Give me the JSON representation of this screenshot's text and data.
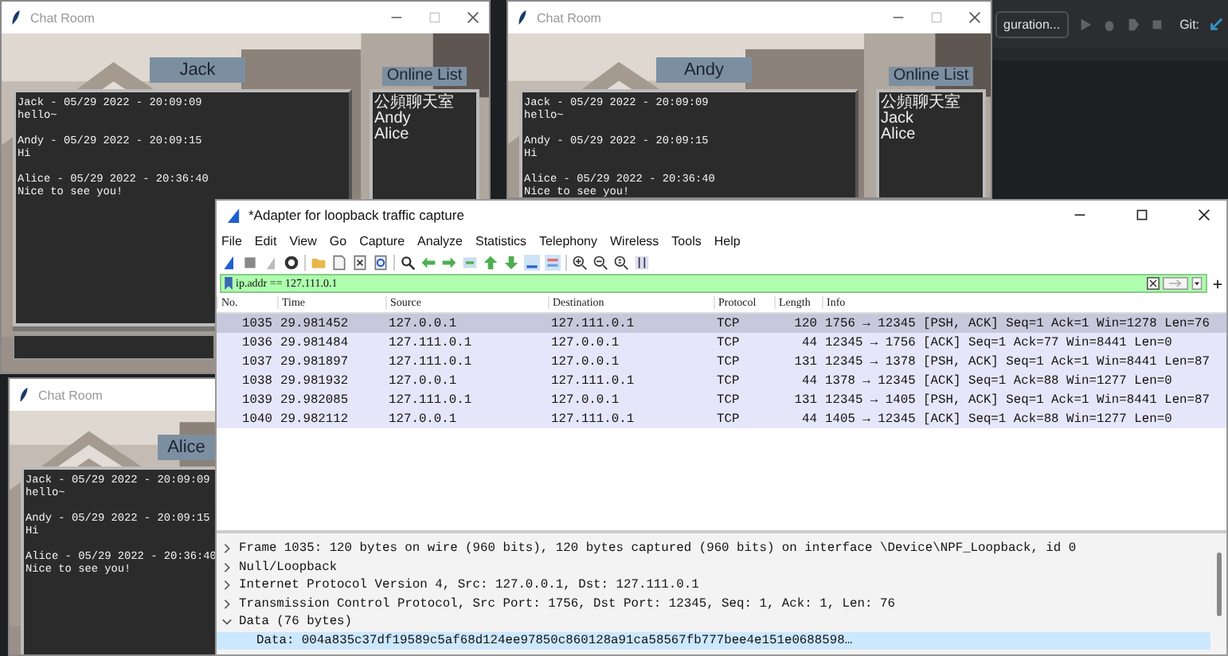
{
  "ide": {
    "run_config": "guration...",
    "vcs_label": "Git:"
  },
  "chat_windows": [
    {
      "title": "Chat Room",
      "title_buttons": true,
      "user": "Jack",
      "show_entry": true,
      "messages": [
        {
          "header": "Jack - 05/29 2022 - 20:09:09",
          "body": "hello~"
        },
        {
          "header": "Andy - 05/29 2022 - 20:09:15",
          "body": "Hi"
        },
        {
          "header": "Alice - 05/29 2022 - 20:36:40",
          "body": "Nice to see you!"
        }
      ],
      "online_list": {
        "title": "Online List",
        "users": [
          "公頻聊天室",
          "Andy",
          "Alice"
        ]
      }
    },
    {
      "title": "Chat Room",
      "title_buttons": true,
      "user": "Andy",
      "show_entry": false,
      "messages": [
        {
          "header": "Jack - 05/29 2022 - 20:09:09",
          "body": "hello~"
        },
        {
          "header": "Andy - 05/29 2022 - 20:09:15",
          "body": "Hi"
        },
        {
          "header": "Alice - 05/29 2022 - 20:36:40",
          "body": "Nice to see you!"
        }
      ],
      "online_list": {
        "title": "Online List",
        "users": [
          "公頻聊天室",
          "Jack",
          "Alice"
        ]
      }
    },
    {
      "title": "Chat Room",
      "title_buttons": false,
      "user": "Alice",
      "show_entry": false,
      "messages": [
        {
          "header": "Jack - 05/29 2022 - 20:09:09",
          "body": "hello~"
        },
        {
          "header": "Andy - 05/29 2022 - 20:09:15",
          "body": "Hi"
        },
        {
          "header": "Alice - 05/29 2022 - 20:36:40",
          "body": "Nice to see you!"
        }
      ]
    }
  ],
  "capture_window": {
    "title": "*Adapter for loopback traffic capture",
    "menu": [
      "File",
      "Edit",
      "View",
      "Go",
      "Capture",
      "Analyze",
      "Statistics",
      "Telephony",
      "Wireless",
      "Tools",
      "Help"
    ],
    "filter": "ip.addr == 127.111.0.1",
    "columns": [
      "No.",
      "Time",
      "Source",
      "Destination",
      "Protocol",
      "Length",
      "Info"
    ],
    "packets": [
      {
        "no": "1035",
        "time": "29.981452",
        "source": "127.0.0.1",
        "destination": "127.111.0.1",
        "protocol": "TCP",
        "length": "120",
        "info": "1756 → 12345 [PSH, ACK] Seq=1 Ack=1 Win=1278 Len=76",
        "selected": true
      },
      {
        "no": "1036",
        "time": "29.981484",
        "source": "127.111.0.1",
        "destination": "127.0.0.1",
        "protocol": "TCP",
        "length": "44",
        "info": "12345 → 1756 [ACK] Seq=1 Ack=77 Win=8441 Len=0",
        "selected": false
      },
      {
        "no": "1037",
        "time": "29.981897",
        "source": "127.111.0.1",
        "destination": "127.0.0.1",
        "protocol": "TCP",
        "length": "131",
        "info": "12345 → 1378 [PSH, ACK] Seq=1 Ack=1 Win=8441 Len=87",
        "selected": false
      },
      {
        "no": "1038",
        "time": "29.981932",
        "source": "127.0.0.1",
        "destination": "127.111.0.1",
        "protocol": "TCP",
        "length": "44",
        "info": "1378 → 12345 [ACK] Seq=1 Ack=88 Win=1277 Len=0",
        "selected": false
      },
      {
        "no": "1039",
        "time": "29.982085",
        "source": "127.111.0.1",
        "destination": "127.0.0.1",
        "protocol": "TCP",
        "length": "131",
        "info": "12345 → 1405 [PSH, ACK] Seq=1 Ack=1 Win=8441 Len=87",
        "selected": false
      },
      {
        "no": "1040",
        "time": "29.982112",
        "source": "127.0.0.1",
        "destination": "127.111.0.1",
        "protocol": "TCP",
        "length": "44",
        "info": "1405 → 12345 [ACK] Seq=1 Ack=88 Win=1277 Len=0",
        "selected": false
      }
    ],
    "details": [
      {
        "label": "Frame 1035: 120 bytes on wire (960 bits), 120 bytes captured (960 bits) on interface \\Device\\NPF_Loopback, id 0",
        "expanded": false,
        "selected": false
      },
      {
        "label": "Null/Loopback",
        "expanded": false,
        "selected": false
      },
      {
        "label": "Internet Protocol Version 4, Src: 127.0.0.1, Dst: 127.111.0.1",
        "expanded": false,
        "selected": false
      },
      {
        "label": "Transmission Control Protocol, Src Port: 1756, Dst Port: 12345, Seq: 1, Ack: 1, Len: 76",
        "expanded": false,
        "selected": false
      },
      {
        "label": "Data (76 bytes)",
        "expanded": true,
        "selected": false,
        "children": [
          {
            "label": "Data: 004a835c37df19589c5af68d124ee97850c860128a91ca58567fb777bee4e151e0688598…",
            "selected": true
          }
        ]
      }
    ]
  }
}
